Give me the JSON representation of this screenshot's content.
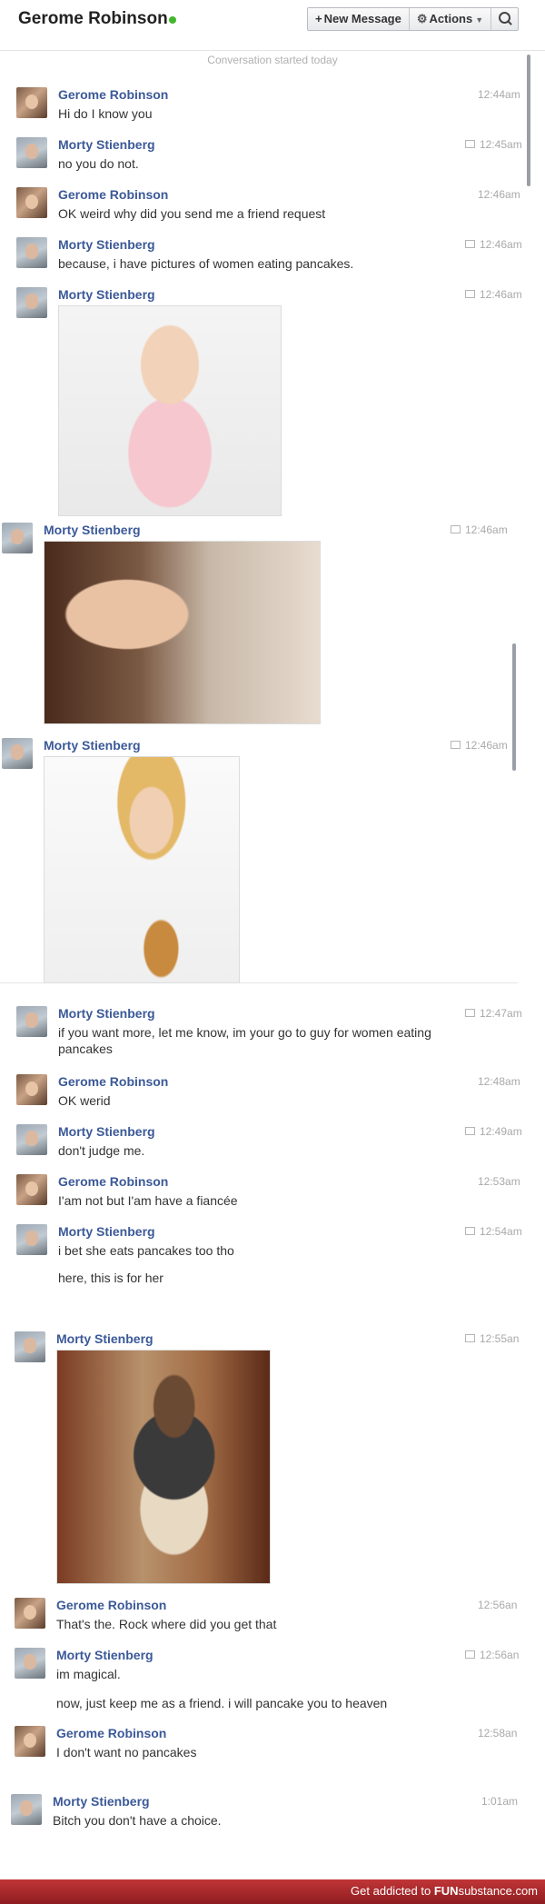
{
  "header": {
    "title": "Gerome Robinson",
    "new_message": "New Message",
    "actions": "Actions"
  },
  "conversation_started": "Conversation started today",
  "messages": [
    {
      "sender": "Gerome Robinson",
      "time": "12:44am",
      "lines": [
        "Hi do I know you"
      ]
    },
    {
      "sender": "Morty Stienberg",
      "time": "12:45am",
      "lines": [
        "no you do not."
      ]
    },
    {
      "sender": "Gerome Robinson",
      "time": "12:46am",
      "lines": [
        "OK weird why did you send me a friend request"
      ]
    },
    {
      "sender": "Morty Stienberg",
      "time": "12:46am",
      "lines": [
        "because, i have pictures of women eating pancakes."
      ]
    },
    {
      "sender": "Morty Stienberg",
      "time": "12:46am",
      "photo": "photo-woman-pancakes"
    },
    {
      "sender": "Morty Stienberg",
      "time": "12:46am",
      "photo": "photo-woman-fork"
    },
    {
      "sender": "Morty Stienberg",
      "time": "12:46am",
      "photo": "photo-woman-sandwich"
    },
    {
      "sender": "Morty Stienberg",
      "time": "12:47am",
      "lines": [
        "if you want more, let me know, im your go to guy for women eating",
        "pancakes"
      ]
    },
    {
      "sender": "Gerome Robinson",
      "time": "12:48am",
      "lines": [
        "OK werid"
      ]
    },
    {
      "sender": "Morty Stienberg",
      "time": "12:49am",
      "lines": [
        "don't judge me."
      ]
    },
    {
      "sender": "Gerome Robinson",
      "time": "12:53am",
      "lines": [
        "I'am not but I'am have a fiancée"
      ]
    },
    {
      "sender": "Morty Stienberg",
      "time": "12:54am",
      "lines": [
        "i bet she eats pancakes too tho",
        "here, this is for her"
      ]
    },
    {
      "sender": "Morty Stienberg",
      "time": "12:55an",
      "photo": "photo-rock-pancakes"
    },
    {
      "sender": "Gerome Robinson",
      "time": "12:56an",
      "lines": [
        "That's the. Rock where did you get that"
      ]
    },
    {
      "sender": "Morty Stienberg",
      "time": "12:56an",
      "lines": [
        "im magical.",
        "now, just keep me as a friend. i will pancake you to heaven"
      ]
    },
    {
      "sender": "Gerome Robinson",
      "time": "12:58an",
      "lines": [
        "I don't want no pancakes"
      ]
    },
    {
      "sender": "Morty Stienberg",
      "time": "1:01am",
      "lines": [
        "Bitch you don't have a choice."
      ]
    }
  ],
  "footer": {
    "prefix": "Get addicted to",
    "brand_bold": "FUN",
    "brand_rest": "substance",
    "domain": ".com"
  },
  "colors": {
    "sender_name": "#3b5998",
    "online": "#42b72a",
    "footer": "#a8282b"
  }
}
